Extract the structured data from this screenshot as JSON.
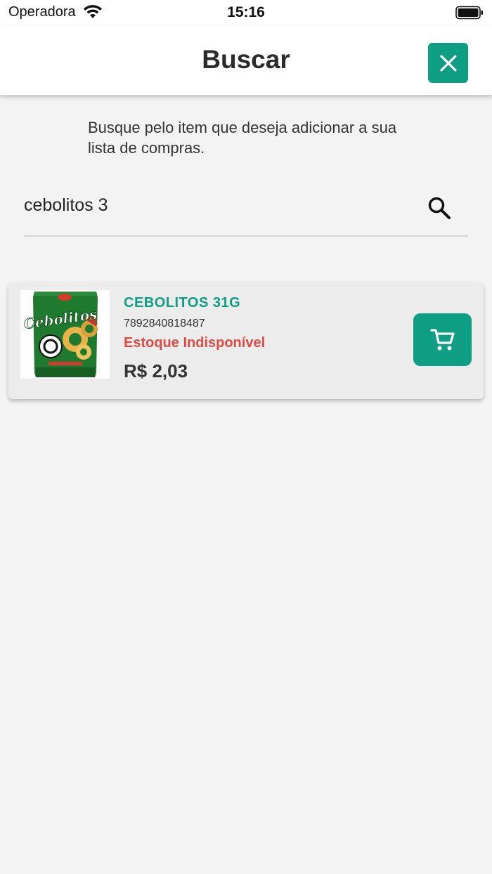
{
  "status_bar": {
    "carrier": "Operadora",
    "time": "15:16"
  },
  "header": {
    "title": "Buscar",
    "close_icon": "close-icon"
  },
  "search": {
    "instructions": "Busque pelo item que deseja adicionar a sua lista de compras.",
    "value": "cebolitos 3",
    "icon": "search-icon"
  },
  "results": [
    {
      "name": "CEBOLITOS 31G",
      "barcode": "7892840818487",
      "stock_status": "Estoque Indisponível",
      "price": "R$ 2,03",
      "image_text": "Cebolitos",
      "cart_icon": "cart-icon"
    }
  ],
  "colors": {
    "accent": "#0e9e84",
    "error": "#e14a43",
    "background": "#f3f3f3"
  }
}
